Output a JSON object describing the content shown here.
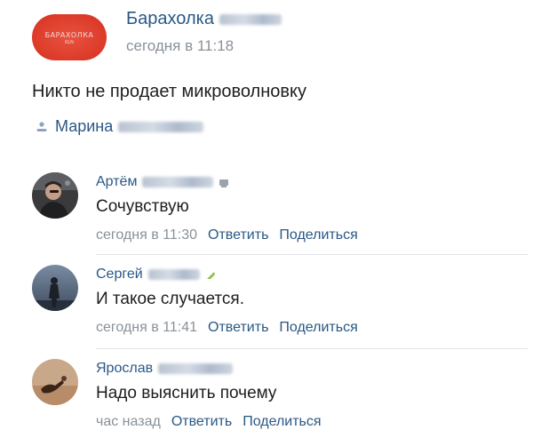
{
  "post": {
    "group_name": "Барахолка",
    "logo_text": "БАРАХОЛКА",
    "logo_sub": "KLN",
    "time": "сегодня в 11:18",
    "text": "Никто не продает микроволновку",
    "author": "Марина"
  },
  "comments": [
    {
      "author": "Артём",
      "text": "Сочувствую",
      "time": "сегодня в 11:30",
      "reply": "Ответить",
      "share": "Поделиться"
    },
    {
      "author": "Сергей",
      "text": "И такое случается.",
      "time": "сегодня в 11:41",
      "reply": "Ответить",
      "share": "Поделиться"
    },
    {
      "author": "Ярослав",
      "text": "Надо выяснить почему",
      "time": "час назад",
      "reply": "Ответить",
      "share": "Поделиться"
    }
  ],
  "colors": {
    "link": "#2a5885",
    "muted": "#8a9199",
    "text": "#1e1e1e",
    "brand": "#dd3b2a"
  }
}
